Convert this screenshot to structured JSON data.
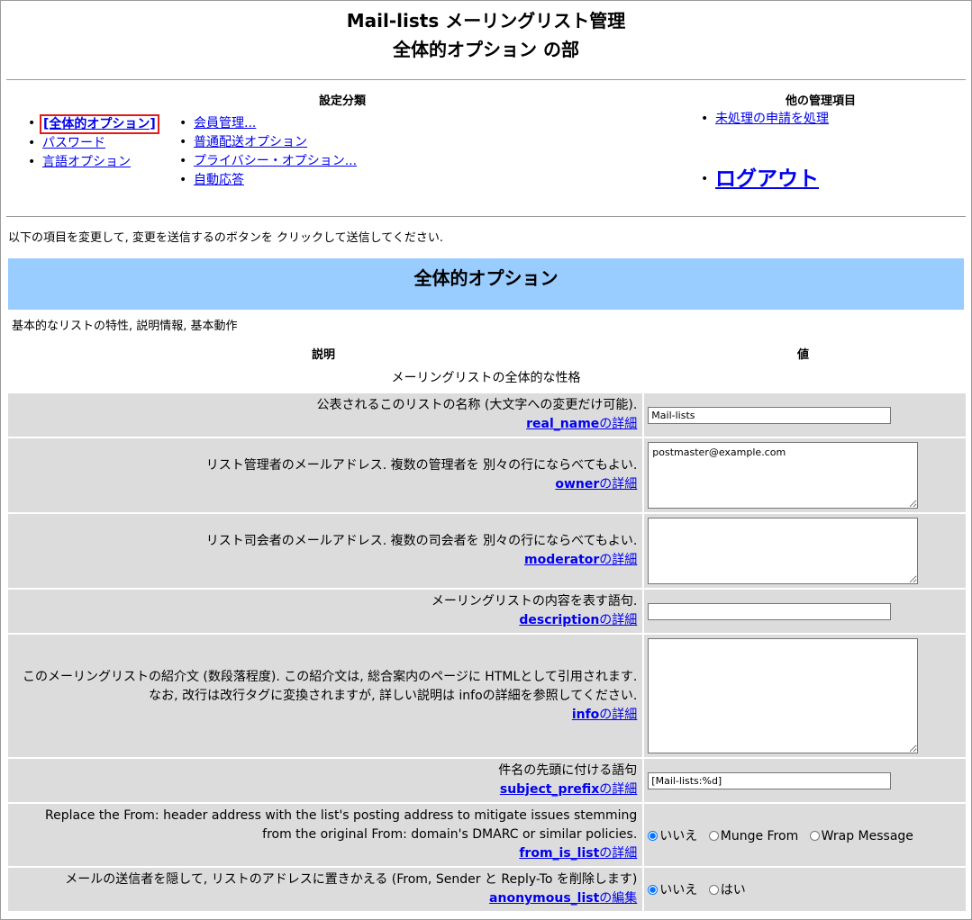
{
  "header": {
    "title_line1": "Mail-lists メーリングリスト管理",
    "title_line2": "全体的オプション の部"
  },
  "nav": {
    "settings_heading": "設定分類",
    "col1": [
      {
        "label": "[全体的オプション]",
        "current": true
      },
      {
        "label": "パスワード"
      },
      {
        "label": "言語オプション"
      }
    ],
    "col2": [
      {
        "label": "会員管理..."
      },
      {
        "label": "普通配送オプション"
      },
      {
        "label": "プライバシー・オプション..."
      },
      {
        "label": "自動応答"
      }
    ],
    "other_heading": "他の管理項目",
    "other_items": [
      {
        "label": "未処理の申請を処理"
      }
    ],
    "logout": "ログアウト"
  },
  "intro": "以下の項目を変更して, 変更を送信するのボタンを クリックして送信してください.",
  "section": {
    "banner": "全体的オプション",
    "description": "基本的なリストの特性, 説明情報, 基本動作",
    "col_desc": "説明",
    "col_value": "値",
    "category": "メーリングリストの全体的な性格"
  },
  "options": {
    "real_name": {
      "desc": "公表されるこのリストの名称 (大文字への変更だけ可能).",
      "help_key": "real_name",
      "help_suffix": "の詳細",
      "value": "Mail-lists"
    },
    "owner": {
      "desc": "リスト管理者のメールアドレス. 複数の管理者を 別々の行にならべてもよい.",
      "help_key": "owner",
      "help_suffix": "の詳細",
      "value": "postmaster@example.com"
    },
    "moderator": {
      "desc": "リスト司会者のメールアドレス. 複数の司会者を 別々の行にならべてもよい.",
      "help_key": "moderator",
      "help_suffix": "の詳細",
      "value": ""
    },
    "description": {
      "desc": "メーリングリストの内容を表す語句.",
      "help_key": "description",
      "help_suffix": "の詳細",
      "value": ""
    },
    "info": {
      "desc": "このメーリングリストの紹介文 (数段落程度). この紹介文は, 総合案内のページに HTMLとして引用されます. なお, 改行は改行タグに変換されますが, 詳しい説明は infoの詳細を参照してください.",
      "help_key": "info",
      "help_suffix": "の詳細",
      "value": ""
    },
    "subject_prefix": {
      "desc": "件名の先頭に付ける語句",
      "help_key": "subject_prefix",
      "help_suffix": "の詳細",
      "value": "[Mail-lists:%d]"
    },
    "from_is_list": {
      "desc_line1": "Replace the From: header address with the list's posting address to mitigate issues stemming",
      "desc_line2": "from the original From: domain's DMARC or similar policies.",
      "help_key": "from_is_list",
      "help_suffix": "の詳細",
      "choices": [
        "いいえ",
        "Munge From",
        "Wrap Message"
      ],
      "selected": "いいえ"
    },
    "anonymous_list": {
      "desc": "メールの送信者を隠して, リストのアドレスに置きかえる (From, Sender と Reply-To を削除します)",
      "help_key": "anonymous_list",
      "help_suffix": "の編集",
      "choices": [
        "いいえ",
        "はい"
      ],
      "selected": "いいえ"
    }
  }
}
